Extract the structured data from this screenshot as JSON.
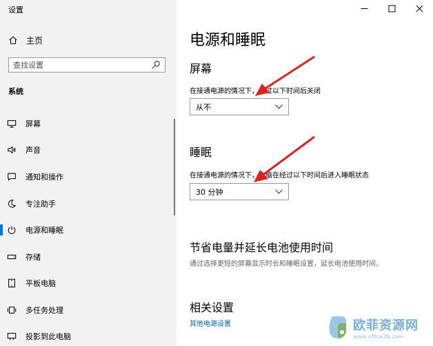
{
  "window": {
    "title": "设置"
  },
  "sidebar": {
    "home_label": "主页",
    "search_placeholder": "查找设置",
    "section_label": "系统",
    "items": [
      {
        "label": "屏幕",
        "icon": "monitor-icon"
      },
      {
        "label": "声音",
        "icon": "speaker-icon"
      },
      {
        "label": "通知和操作",
        "icon": "notification-icon"
      },
      {
        "label": "专注助手",
        "icon": "moon-icon"
      },
      {
        "label": "电源和睡眠",
        "icon": "power-icon",
        "active": true
      },
      {
        "label": "存储",
        "icon": "storage-icon"
      },
      {
        "label": "平板电脑",
        "icon": "tablet-icon"
      },
      {
        "label": "多任务处理",
        "icon": "multitask-icon"
      },
      {
        "label": "投影到此电脑",
        "icon": "projector-icon"
      }
    ]
  },
  "main": {
    "title": "电源和睡眠",
    "screen": {
      "heading": "屏幕",
      "description": "在接通电源的情况下，经过以下时间后关闭",
      "value": "从不"
    },
    "sleep": {
      "heading": "睡眠",
      "description": "在接通电源的情况下，电脑在经过以下时间后进入睡眠状态",
      "value": "30 分钟"
    },
    "battery": {
      "heading": "节省电量并延长电池使用时间",
      "description": "通过选择更短的屏幕显示时长和睡眠设置，延长电池使用时间。"
    },
    "related": {
      "heading": "相关设置",
      "link": "其他电源设置"
    }
  },
  "watermark": {
    "name": "欧菲资源网",
    "url": "www.office26.com"
  },
  "colors": {
    "accent": "#0078d7",
    "sidebar_bg": "#f2f2f2",
    "link": "#0066b4",
    "annotation_arrow": "#e02020"
  }
}
